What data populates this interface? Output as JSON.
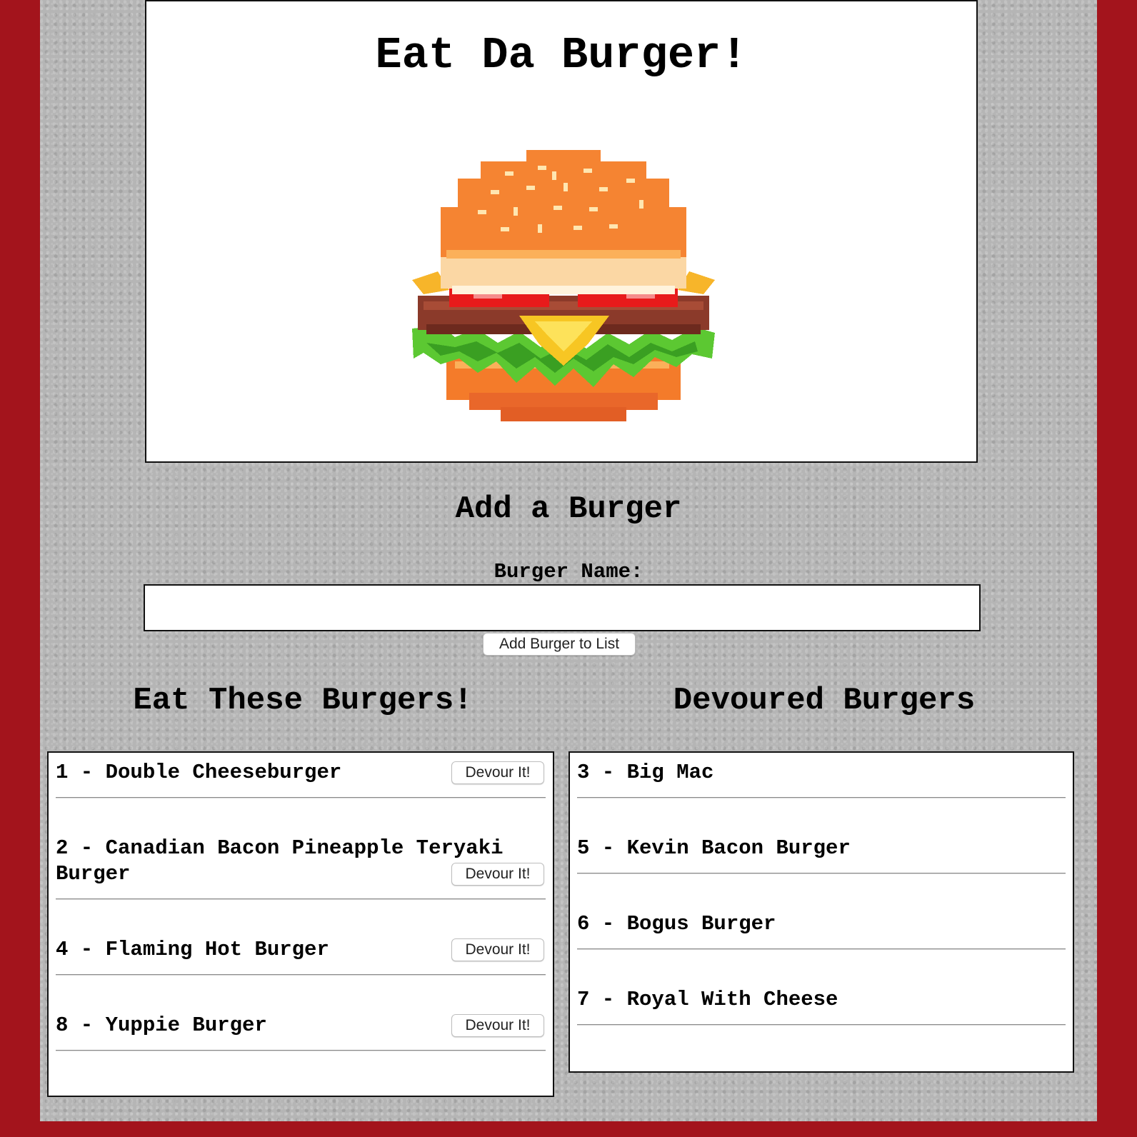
{
  "header": {
    "title": "Eat Da Burger!"
  },
  "add_form": {
    "title": "Add a Burger",
    "name_label": "Burger Name:",
    "name_value": "",
    "submit_label": "Add Burger to List"
  },
  "eat_list": {
    "title": "Eat These Burgers!",
    "button_label": "Devour It!",
    "items": [
      {
        "label": "1 - Double Cheeseburger"
      },
      {
        "label": "2 - Canadian Bacon Pineapple Teryaki Burger"
      },
      {
        "label": "4 - Flaming Hot Burger"
      },
      {
        "label": "8 - Yuppie Burger"
      }
    ]
  },
  "devoured_list": {
    "title": "Devoured Burgers",
    "items": [
      {
        "label": "3 - Big Mac"
      },
      {
        "label": "5 - Kevin Bacon Burger"
      },
      {
        "label": "6 - Bogus Burger"
      },
      {
        "label": "7 - Royal With Cheese"
      }
    ]
  },
  "colors": {
    "frame": "#a3141c",
    "wall": "#b5b5b5"
  },
  "icons": {
    "hero_image": "pixel-burger-icon"
  }
}
